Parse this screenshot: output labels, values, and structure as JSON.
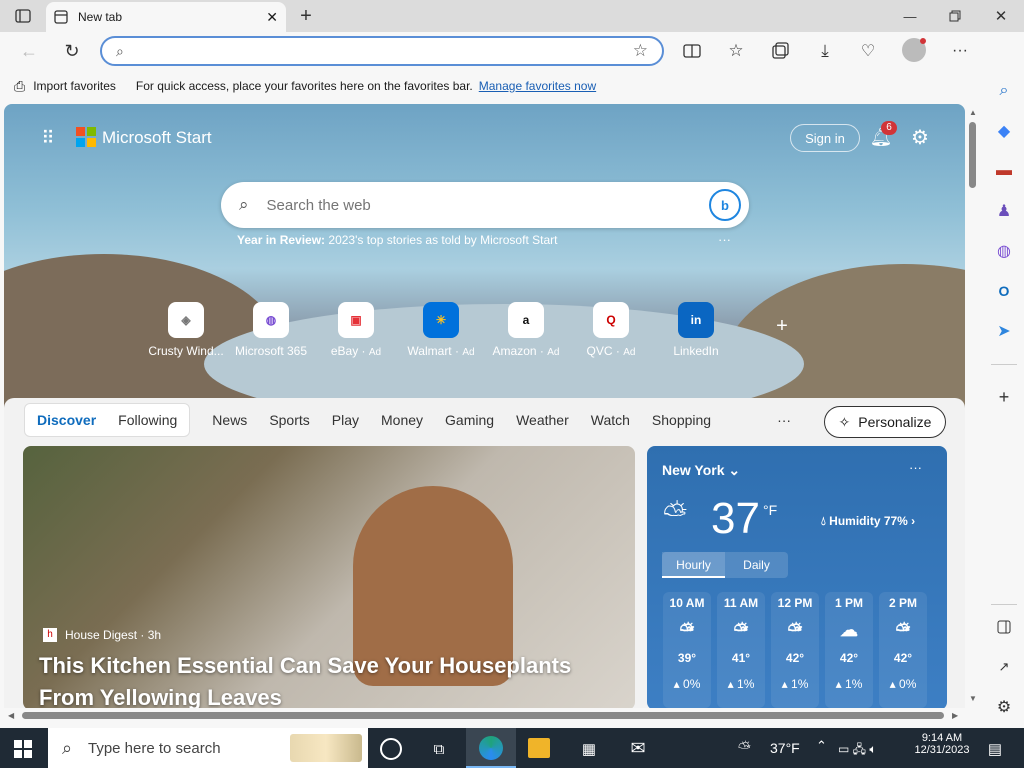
{
  "browser": {
    "tab_title": "New tab",
    "address_value": "",
    "favorites": {
      "import_label": "Import favorites",
      "hint_text": "For quick access, place your favorites here on the favorites bar.",
      "manage_link": "Manage favorites now"
    }
  },
  "start": {
    "brand": "Microsoft Start",
    "sign_in": "Sign in",
    "notification_count": "6",
    "search_placeholder": "Search the web",
    "yir_bold": "Year in Review:",
    "yir_text": "2023's top stories as told by Microsoft Start",
    "quick_links": [
      {
        "label": "Crusty Wind...",
        "icon": "crusty-icon"
      },
      {
        "label": "Microsoft 365",
        "icon": "m365-icon"
      },
      {
        "label": "eBay",
        "ad": "Ad",
        "icon": "ebay-icon"
      },
      {
        "label": "Walmart",
        "ad": "Ad",
        "icon": "walmart-icon"
      },
      {
        "label": "Amazon",
        "ad": "Ad",
        "icon": "amazon-icon"
      },
      {
        "label": "QVC",
        "ad": "Ad",
        "icon": "qvc-icon"
      },
      {
        "label": "LinkedIn",
        "icon": "linkedin-icon"
      }
    ],
    "feed_tabs": [
      "Discover",
      "Following",
      "News",
      "Sports",
      "Play",
      "Money",
      "Gaming",
      "Weather",
      "Watch",
      "Shopping"
    ],
    "personalize": "Personalize"
  },
  "article": {
    "source": "House Digest · 3h",
    "headline": "This Kitchen Essential Can Save Your Houseplants From Yellowing Leaves"
  },
  "weather": {
    "city": "New York",
    "temp": "37",
    "unit": "°F",
    "humidity": "Humidity 77%",
    "toggle_hourly": "Hourly",
    "toggle_daily": "Daily",
    "hours": [
      {
        "time": "10 AM",
        "temp": "39°",
        "precip": "0%"
      },
      {
        "time": "11 AM",
        "temp": "41°",
        "precip": "1%"
      },
      {
        "time": "12 PM",
        "temp": "42°",
        "precip": "1%"
      },
      {
        "time": "1 PM",
        "temp": "42°",
        "precip": "1%"
      },
      {
        "time": "2 PM",
        "temp": "42°",
        "precip": "0%"
      }
    ]
  },
  "taskbar": {
    "search_placeholder": "Type here to search",
    "weather_temp": "37°F",
    "time": "9:14 AM",
    "date": "12/31/2023"
  },
  "colors": {
    "accent": "#0f6cbd",
    "link": "#1a5fb4",
    "taskbar": "#1f2a35"
  }
}
